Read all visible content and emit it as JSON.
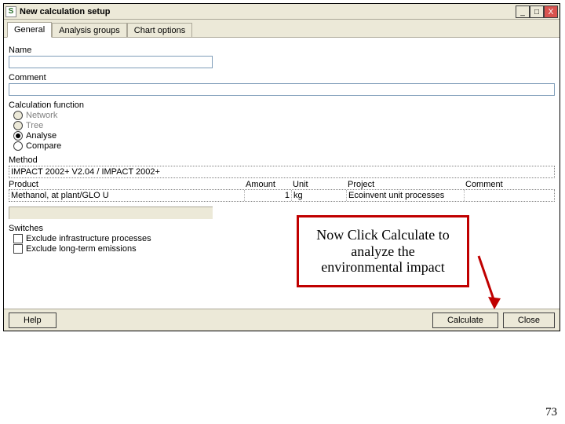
{
  "window": {
    "title": "New calculation setup",
    "app_icon_letter": "S",
    "buttons": {
      "minimize": "_",
      "maximize": "□",
      "close": "X"
    }
  },
  "tabs": {
    "general": "General",
    "analysis_groups": "Analysis groups",
    "chart_options": "Chart options"
  },
  "general": {
    "name_label": "Name",
    "name_value": "",
    "comment_label": "Comment",
    "comment_value": "",
    "calc_function_label": "Calculation function",
    "radios": {
      "network": "Network",
      "tree": "Tree",
      "analyse": "Analyse",
      "compare": "Compare"
    },
    "method_label": "Method",
    "method_value": "IMPACT 2002+ V2.04 / IMPACT 2002+",
    "product_header": {
      "product": "Product",
      "amount": "Amount",
      "unit": "Unit",
      "project": "Project",
      "comment": "Comment"
    },
    "product_row": {
      "product": "Methanol, at plant/GLO U",
      "amount": "1",
      "unit": "kg",
      "project": "Ecoinvent unit processes",
      "comment": ""
    },
    "switches_label": "Switches",
    "switches": {
      "exclude_infra": "Exclude infrastructure processes",
      "exclude_longterm": "Exclude long-term emissions"
    }
  },
  "footer": {
    "help": "Help",
    "calculate": "Calculate",
    "close": "Close"
  },
  "callout_text": "Now Click Calculate to analyze the environmental impact",
  "page_number": "73"
}
